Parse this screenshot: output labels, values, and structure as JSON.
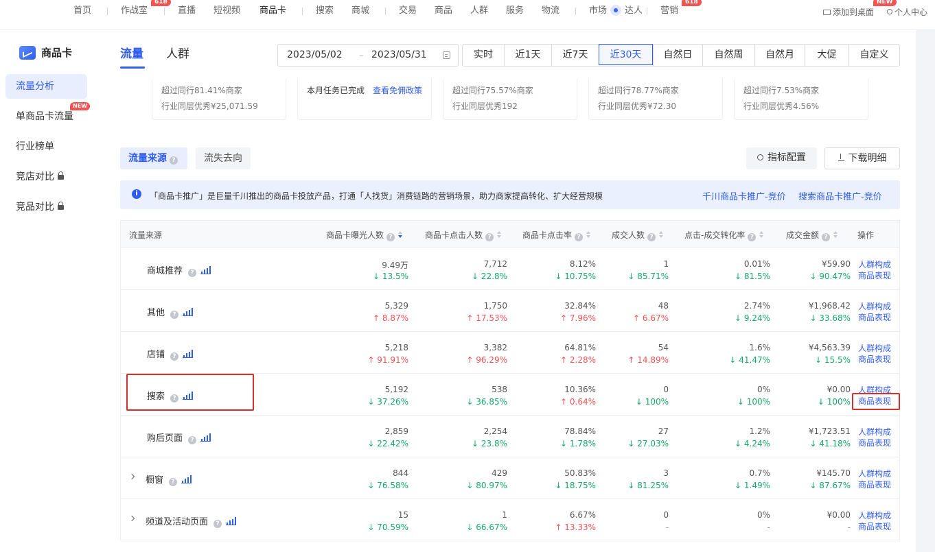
{
  "topnav": {
    "items": [
      {
        "label": "首页"
      },
      {
        "label": "作战室",
        "badge": "618"
      },
      {
        "label": "直播"
      },
      {
        "label": "短视频"
      },
      {
        "label": "商品卡",
        "active": true
      },
      {
        "label": "搜索"
      },
      {
        "label": "商城"
      },
      {
        "label": "交易"
      },
      {
        "label": "商品"
      },
      {
        "label": "人群"
      },
      {
        "label": "服务"
      },
      {
        "label": "物流"
      },
      {
        "label": "市场"
      },
      {
        "label": "达人"
      },
      {
        "label": "营销",
        "badge": "618"
      }
    ],
    "add_desktop": "添加到桌面",
    "user_center": "个人中心",
    "new_badge": "NEW"
  },
  "sidebar": {
    "brand": "商品卡",
    "items": [
      {
        "label": "流量分析",
        "active": true
      },
      {
        "label": "单商品卡流量",
        "badge": "NEW"
      },
      {
        "label": "行业榜单"
      },
      {
        "label": "竞店对比",
        "locked": true
      },
      {
        "label": "竞品对比",
        "locked": true
      }
    ]
  },
  "main": {
    "tabs": [
      {
        "label": "流量",
        "active": true
      },
      {
        "label": "人群"
      }
    ],
    "date_start": "2023/05/02",
    "date_end": "2023/05/31",
    "date_sep": "–",
    "periods": [
      "实时",
      "近1天",
      "近7天",
      "近30天",
      "自然日",
      "自然周",
      "自然月",
      "大促",
      "自定义"
    ],
    "active_period": "近30天"
  },
  "cards": [
    {
      "line1": "超过同行81.41%商家",
      "line2": "行业同层优秀¥25,071.59"
    },
    {
      "line1": "本月任务已完成",
      "link": "查看免佣政策"
    },
    {
      "line1": "超过同行75.57%商家",
      "line2": "行业同层优秀192"
    },
    {
      "line1": "超过同行78.77%商家",
      "line2": "行业同层优秀¥72.30"
    },
    {
      "line1": "超过同行7.53%商家",
      "line2": "行业同层优秀4.56%"
    }
  ],
  "subtabs": [
    "流量来源",
    "流失去向"
  ],
  "actions": {
    "metric_config": "指标配置",
    "download": "下载明细"
  },
  "notice": {
    "text": "「商品卡推广」是巨量千川推出的商品卡投放产品，打通「人找货」消费链路的营销场景，助力商家提高转化、扩大经营规模",
    "link1": "千川商品卡推广-竞价",
    "link2": "搜索商品卡推广-竞价"
  },
  "table": {
    "columns": [
      "流量来源",
      "商品卡曝光人数",
      "商品卡点击人数",
      "商品卡点击率",
      "成交人数",
      "点击-成交转化率",
      "成交金额",
      "操作"
    ],
    "op1": "人群构成",
    "op2": "商品表现",
    "rows": [
      {
        "name": "商城推荐",
        "vals": [
          "9.49万",
          "7,712",
          "8.12%",
          "1",
          "0.01%",
          "¥59.90"
        ],
        "chg": [
          "13.5%",
          "22.8%",
          "10.75%",
          "85.71%",
          "81.5%",
          "90.47%"
        ],
        "dir": [
          "dn",
          "dn",
          "dn",
          "dn",
          "dn",
          "dn"
        ]
      },
      {
        "name": "其他",
        "vals": [
          "5,329",
          "1,750",
          "32.84%",
          "48",
          "2.74%",
          "¥1,968.42"
        ],
        "chg": [
          "8.87%",
          "17.53%",
          "7.96%",
          "6.67%",
          "9.24%",
          "33.68%"
        ],
        "dir": [
          "up",
          "up",
          "up",
          "up",
          "dn",
          "dn"
        ]
      },
      {
        "name": "店铺",
        "vals": [
          "5,218",
          "3,382",
          "64.81%",
          "54",
          "1.6%",
          "¥4,563.39"
        ],
        "chg": [
          "91.91%",
          "96.29%",
          "2.28%",
          "14.89%",
          "41.47%",
          "15.5%"
        ],
        "dir": [
          "up",
          "up",
          "up",
          "up",
          "dn",
          "dn"
        ]
      },
      {
        "name": "搜索",
        "vals": [
          "5,192",
          "538",
          "10.36%",
          "0",
          "0%",
          "¥0.00"
        ],
        "chg": [
          "37.26%",
          "36.85%",
          "0.64%",
          "100%",
          "100%",
          "100%"
        ],
        "dir": [
          "dn",
          "dn",
          "up",
          "dn",
          "dn",
          "dn"
        ]
      },
      {
        "name": "购后页面",
        "vals": [
          "2,859",
          "2,254",
          "78.84%",
          "27",
          "1.2%",
          "¥1,723.51"
        ],
        "chg": [
          "22.42%",
          "23.8%",
          "1.78%",
          "27.03%",
          "4.24%",
          "41.18%"
        ],
        "dir": [
          "dn",
          "dn",
          "dn",
          "dn",
          "dn",
          "dn"
        ]
      },
      {
        "name": "橱窗",
        "vals": [
          "844",
          "429",
          "50.83%",
          "3",
          "0.7%",
          "¥145.70"
        ],
        "chg": [
          "76.58%",
          "80.97%",
          "18.75%",
          "81.25%",
          "1.49%",
          "87.67%"
        ],
        "dir": [
          "dn",
          "dn",
          "dn",
          "dn",
          "dn",
          "dn"
        ]
      },
      {
        "name": "频道及活动页面",
        "vals": [
          "15",
          "1",
          "6.67%",
          "0",
          "0%",
          "¥0.00"
        ],
        "chg": [
          "70.59%",
          "66.67%",
          "13.33%",
          "-",
          "-",
          "-"
        ],
        "dir": [
          "dn",
          "dn",
          "up",
          "nu",
          "nu",
          "nu"
        ]
      }
    ]
  },
  "colors": {
    "accent": "#2f5cf0",
    "up": "#f25353",
    "down": "#16a86a",
    "highlight": "#d83028"
  }
}
